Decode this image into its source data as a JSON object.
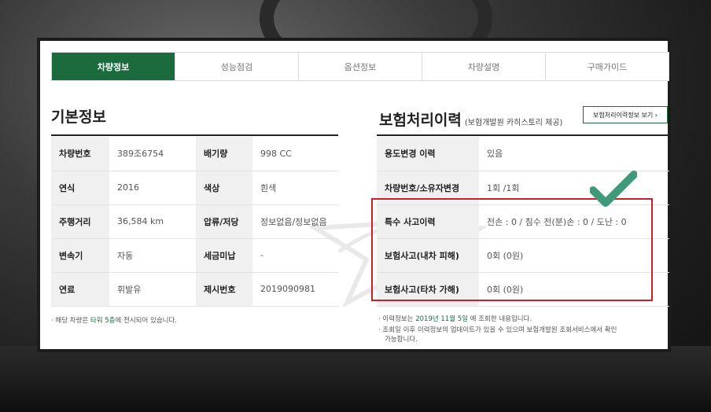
{
  "tabs": [
    "차량정보",
    "성능점검",
    "옵션정보",
    "차량설명",
    "구매가이드"
  ],
  "basic": {
    "title": "기본정보",
    "rows": [
      {
        "k1": "차량번호",
        "v1": "389조6754",
        "k2": "배기량",
        "v2": "998 CC"
      },
      {
        "k1": "연식",
        "v1": "2016",
        "k2": "색상",
        "v2": "흰색"
      },
      {
        "k1": "주행거리",
        "v1": "36,584 km",
        "k2": "압류/저당",
        "v2": "정보없음/정보없음"
      },
      {
        "k1": "변속기",
        "v1": "자동",
        "k2": "세금미납",
        "v2": "-"
      },
      {
        "k1": "연료",
        "v1": "휘발유",
        "k2": "제시번호",
        "v2": "2019090981"
      }
    ],
    "note_prefix": "· 해당 차량은 ",
    "note_highlight": "타워 5층",
    "note_suffix": "에 전시되어 있습니다."
  },
  "insurance": {
    "title": "보험처리이력",
    "subtitle": "(보험개발원 카히스토리 제공)",
    "button": "보험처리이력정보 보기 ›",
    "rows": [
      {
        "k": "용도변경 이력",
        "v": "있음"
      },
      {
        "k": "차량번호/소유자변경",
        "v": "1회 /1회"
      },
      {
        "k": "특수 사고이력",
        "v": "전손 : 0 / 침수 전(분)손 : 0 / 도난 : 0"
      },
      {
        "k": "보험사고(내차 피해)",
        "v": "0회 (0원)"
      },
      {
        "k": "보험사고(타차 가해)",
        "v": "0회 (0원)"
      }
    ],
    "note1_prefix": "· 이력정보는 ",
    "note1_highlight": "2019년 11월 5일",
    "note1_suffix": " 에 조회한 내용입니다.",
    "note2_line1": "· 조회일 이후 이력정보의 업데이트가 있을 수 있으며 보험개발원 조회서비스에서 확인",
    "note2_line2": "가능합니다."
  },
  "colors": {
    "accent": "#1b6b3e",
    "highlight_box": "#c8202a",
    "check": "#3f9a7a"
  }
}
